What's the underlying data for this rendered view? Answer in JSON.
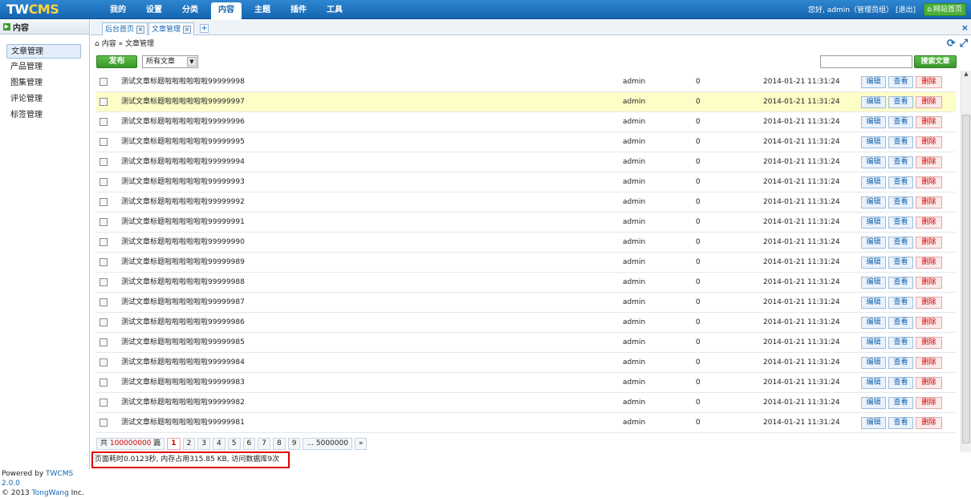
{
  "topbar": {
    "logo": "TWCMS",
    "nav": [
      "我的",
      "设置",
      "分类",
      "内容",
      "主题",
      "插件",
      "工具"
    ],
    "active_nav": "内容",
    "greeting": "您好, admin（管理员组）",
    "logout": "[退出]",
    "home_button": "网站首页"
  },
  "sidebar": {
    "title": "内容",
    "items": [
      "文章管理",
      "产品管理",
      "图集管理",
      "评论管理",
      "标签管理"
    ],
    "powered_prefix": "Powered by ",
    "powered_link": "TWCMS 2.0.0",
    "copyright_prefix": "© 2013 ",
    "copyright_link": "TongWang",
    "copyright_suffix": " Inc."
  },
  "tabs": {
    "items": [
      "后台首页",
      "文章管理"
    ],
    "add": "+",
    "close": "×"
  },
  "breadcrumb": "内容 » 文章管理",
  "toolbar": {
    "publish": "发布",
    "filter_selected": "所有文章",
    "search_button": "搜索文章"
  },
  "actions": {
    "edit": "编辑",
    "view": "查看",
    "delete": "删除"
  },
  "rows": [
    {
      "title": "测试文章标题啦啦啦啦啦啦99999998",
      "author": "admin",
      "views": "0",
      "date": "2014-01-21 11:31:24"
    },
    {
      "title": "测试文章标题啦啦啦啦啦啦99999997",
      "author": "admin",
      "views": "0",
      "date": "2014-01-21 11:31:24"
    },
    {
      "title": "测试文章标题啦啦啦啦啦啦99999996",
      "author": "admin",
      "views": "0",
      "date": "2014-01-21 11:31:24"
    },
    {
      "title": "测试文章标题啦啦啦啦啦啦99999995",
      "author": "admin",
      "views": "0",
      "date": "2014-01-21 11:31:24"
    },
    {
      "title": "测试文章标题啦啦啦啦啦啦99999994",
      "author": "admin",
      "views": "0",
      "date": "2014-01-21 11:31:24"
    },
    {
      "title": "测试文章标题啦啦啦啦啦啦99999993",
      "author": "admin",
      "views": "0",
      "date": "2014-01-21 11:31:24"
    },
    {
      "title": "测试文章标题啦啦啦啦啦啦99999992",
      "author": "admin",
      "views": "0",
      "date": "2014-01-21 11:31:24"
    },
    {
      "title": "测试文章标题啦啦啦啦啦啦99999991",
      "author": "admin",
      "views": "0",
      "date": "2014-01-21 11:31:24"
    },
    {
      "title": "测试文章标题啦啦啦啦啦啦99999990",
      "author": "admin",
      "views": "0",
      "date": "2014-01-21 11:31:24"
    },
    {
      "title": "测试文章标题啦啦啦啦啦啦99999989",
      "author": "admin",
      "views": "0",
      "date": "2014-01-21 11:31:24"
    },
    {
      "title": "测试文章标题啦啦啦啦啦啦99999988",
      "author": "admin",
      "views": "0",
      "date": "2014-01-21 11:31:24"
    },
    {
      "title": "测试文章标题啦啦啦啦啦啦99999987",
      "author": "admin",
      "views": "0",
      "date": "2014-01-21 11:31:24"
    },
    {
      "title": "测试文章标题啦啦啦啦啦啦99999986",
      "author": "admin",
      "views": "0",
      "date": "2014-01-21 11:31:24"
    },
    {
      "title": "测试文章标题啦啦啦啦啦啦99999985",
      "author": "admin",
      "views": "0",
      "date": "2014-01-21 11:31:24"
    },
    {
      "title": "测试文章标题啦啦啦啦啦啦99999984",
      "author": "admin",
      "views": "0",
      "date": "2014-01-21 11:31:24"
    },
    {
      "title": "测试文章标题啦啦啦啦啦啦99999983",
      "author": "admin",
      "views": "0",
      "date": "2014-01-21 11:31:24"
    },
    {
      "title": "测试文章标题啦啦啦啦啦啦99999982",
      "author": "admin",
      "views": "0",
      "date": "2014-01-21 11:31:24"
    },
    {
      "title": "测试文章标题啦啦啦啦啦啦99999981",
      "author": "admin",
      "views": "0",
      "date": "2014-01-21 11:31:24"
    }
  ],
  "highlight_row_index": 1,
  "pager": {
    "total_prefix": "共 ",
    "total": "100000000",
    "total_suffix": " 篇",
    "pages": [
      "1",
      "2",
      "3",
      "4",
      "5",
      "6",
      "7",
      "8",
      "9"
    ],
    "current": "1",
    "last": "... 5000000",
    "next": "»"
  },
  "stats": "页面耗时0.0123秒, 内存占用315.85 KB, 访问数据库9次",
  "colors": {
    "accent": "#1565b0",
    "green": "#38952a",
    "delete": "#cc0000",
    "highlight": "#fdfdc8"
  }
}
